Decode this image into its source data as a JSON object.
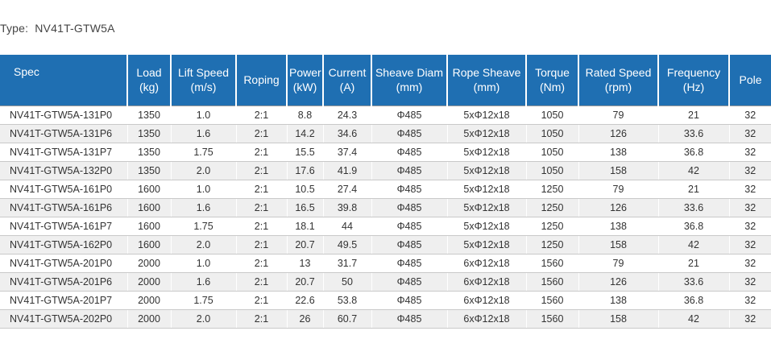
{
  "type_label": "Type:",
  "type_value": "NV41T-GTW5A",
  "columns": [
    {
      "name": "Spec",
      "unit": ""
    },
    {
      "name": "Load",
      "unit": "(kg)"
    },
    {
      "name": "Lift Speed",
      "unit": "(m/s)"
    },
    {
      "name": "Roping",
      "unit": ""
    },
    {
      "name": "Power",
      "unit": "(kW)"
    },
    {
      "name": "Current",
      "unit": "(A)"
    },
    {
      "name": "Sheave Diam",
      "unit": "(mm)"
    },
    {
      "name": "Rope Sheave",
      "unit": "(mm)"
    },
    {
      "name": "Torque",
      "unit": "(Nm)"
    },
    {
      "name": "Rated Speed",
      "unit": "(rpm)"
    },
    {
      "name": "Frequency",
      "unit": "(Hz)"
    },
    {
      "name": "Pole",
      "unit": ""
    }
  ],
  "rows": [
    [
      "NV41T-GTW5A-131P0",
      "1350",
      "1.0",
      "2:1",
      "8.8",
      "24.3",
      "Φ485",
      "5xΦ12x18",
      "1050",
      "79",
      "21",
      "32"
    ],
    [
      "NV41T-GTW5A-131P6",
      "1350",
      "1.6",
      "2:1",
      "14.2",
      "34.6",
      "Φ485",
      "5xΦ12x18",
      "1050",
      "126",
      "33.6",
      "32"
    ],
    [
      "NV41T-GTW5A-131P7",
      "1350",
      "1.75",
      "2:1",
      "15.5",
      "37.4",
      "Φ485",
      "5xΦ12x18",
      "1050",
      "138",
      "36.8",
      "32"
    ],
    [
      "NV41T-GTW5A-132P0",
      "1350",
      "2.0",
      "2:1",
      "17.6",
      "41.9",
      "Φ485",
      "5xΦ12x18",
      "1050",
      "158",
      "42",
      "32"
    ],
    [
      "NV41T-GTW5A-161P0",
      "1600",
      "1.0",
      "2:1",
      "10.5",
      "27.4",
      "Φ485",
      "5xΦ12x18",
      "1250",
      "79",
      "21",
      "32"
    ],
    [
      "NV41T-GTW5A-161P6",
      "1600",
      "1.6",
      "2:1",
      "16.5",
      "39.8",
      "Φ485",
      "5xΦ12x18",
      "1250",
      "126",
      "33.6",
      "32"
    ],
    [
      "NV41T-GTW5A-161P7",
      "1600",
      "1.75",
      "2:1",
      "18.1",
      "44",
      "Φ485",
      "5xΦ12x18",
      "1250",
      "138",
      "36.8",
      "32"
    ],
    [
      "NV41T-GTW5A-162P0",
      "1600",
      "2.0",
      "2:1",
      "20.7",
      "49.5",
      "Φ485",
      "5xΦ12x18",
      "1250",
      "158",
      "42",
      "32"
    ],
    [
      "NV41T-GTW5A-201P0",
      "2000",
      "1.0",
      "2:1",
      "13",
      "31.7",
      "Φ485",
      "6xΦ12x18",
      "1560",
      "79",
      "21",
      "32"
    ],
    [
      "NV41T-GTW5A-201P6",
      "2000",
      "1.6",
      "2:1",
      "20.7",
      "50",
      "Φ485",
      "6xΦ12x18",
      "1560",
      "126",
      "33.6",
      "32"
    ],
    [
      "NV41T-GTW5A-201P7",
      "2000",
      "1.75",
      "2:1",
      "22.6",
      "53.8",
      "Φ485",
      "6xΦ12x18",
      "1560",
      "138",
      "36.8",
      "32"
    ],
    [
      "NV41T-GTW5A-202P0",
      "2000",
      "2.0",
      "2:1",
      "26",
      "60.7",
      "Φ485",
      "6xΦ12x18",
      "1560",
      "158",
      "42",
      "32"
    ]
  ],
  "colors": {
    "header_bg": "#1f6fb2",
    "header_text": "#ffffff",
    "row_alt_bg": "#efefef"
  }
}
